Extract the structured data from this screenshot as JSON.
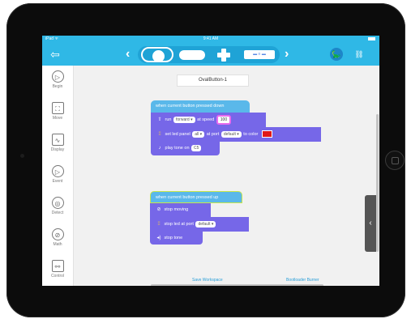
{
  "status_bar": {
    "device": "iPad ᯤ",
    "time": "9:41 AM"
  },
  "toolbar": {
    "back_icon": "⇦",
    "prev_icon": "‹",
    "next_icon": "›",
    "slider_label": "▬ ≡ ▬",
    "accent_color": "#2fb8e6"
  },
  "sidebar": {
    "items": [
      {
        "label": "Begin",
        "icon": "▷"
      },
      {
        "label": "Move",
        "icon": "⛶"
      },
      {
        "label": "Display",
        "icon": "∿"
      },
      {
        "label": "Event",
        "icon": "▷"
      },
      {
        "label": "Detect",
        "icon": "◎"
      },
      {
        "label": "Math",
        "icon": "⊘"
      },
      {
        "label": "Control",
        "icon": "⚯"
      }
    ]
  },
  "canvas": {
    "title": "OvalButton-1",
    "group1": {
      "hat": "when current button pressed down",
      "run": {
        "word": "run",
        "direction": "forward",
        "at": "at speed",
        "speed": "100"
      },
      "led": {
        "word": "set led panel",
        "panel": "all",
        "port_word": "at port",
        "port": "default",
        "to_color": "to color",
        "color": "#e01818"
      },
      "tone": {
        "word": "play tone on",
        "note": "C5"
      }
    },
    "group2": {
      "hat": "when current button pressed up",
      "stop_moving": "stop moving",
      "stop_led": {
        "word": "stop led",
        "port_word": "at port",
        "port": "default"
      },
      "stop_tone": "stop tone"
    },
    "footer": {
      "save": "Save Workspace",
      "bootloader": "Bootloader Burner"
    }
  },
  "side_tab_icon": "‹"
}
